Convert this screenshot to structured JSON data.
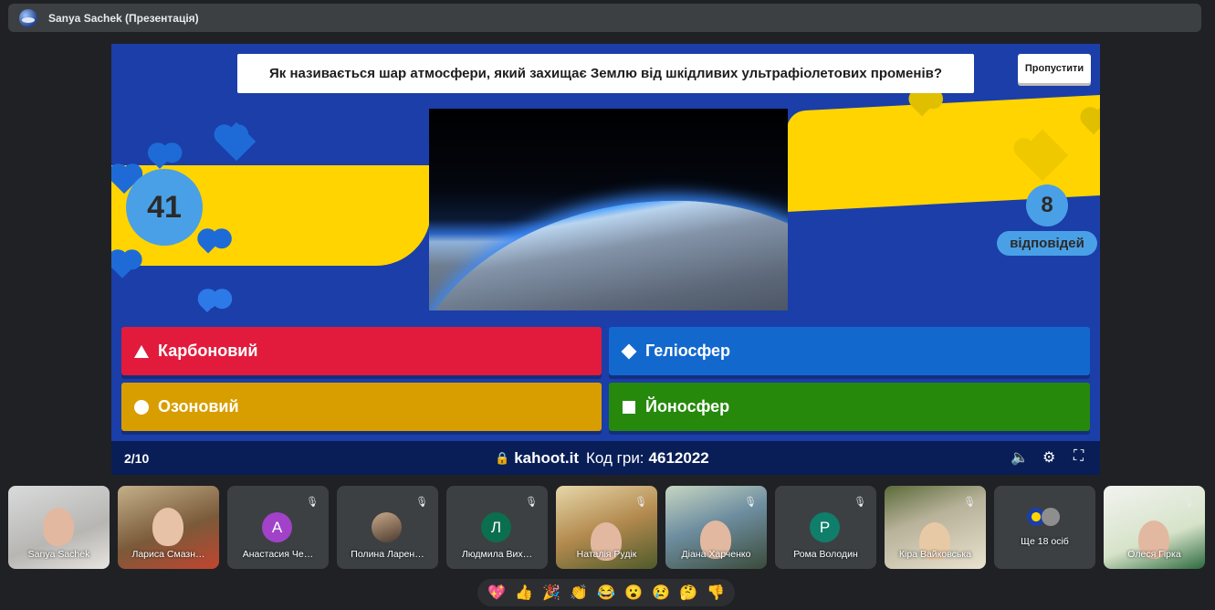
{
  "window": {
    "title": "Sanya Sachek (Презентація)"
  },
  "quiz": {
    "question": "Як називається шар атмосфери, який захищає Землю від шкідливих ультрафіолетових променів?",
    "skip_label": "Пропустити",
    "timer": "41",
    "answers_count": "8",
    "answers_label": "відповідей",
    "options": [
      {
        "shape": "triangle",
        "label": "Карбоновий",
        "color": "#e21b3c"
      },
      {
        "shape": "diamond",
        "label": "Геліосфер",
        "color": "#1368ce"
      },
      {
        "shape": "circle",
        "label": "Озоновий",
        "color": "#d89e00"
      },
      {
        "shape": "square",
        "label": "Йоносфер",
        "color": "#26890c"
      }
    ],
    "footer": {
      "progress": "2/10",
      "site": "kahoot.it",
      "pin_label": "Код гри:",
      "pin": "4612022"
    }
  },
  "participants": [
    {
      "name": "Sanya Sachek",
      "type": "camera"
    },
    {
      "name": "Лариса Смазн…",
      "type": "camera"
    },
    {
      "name": "Анастасия Че…",
      "type": "letter",
      "letter": "А",
      "color": "#a142c9",
      "muted": true
    },
    {
      "name": "Полина Ларен…",
      "type": "photo",
      "muted": true
    },
    {
      "name": "Людмила Вих…",
      "type": "letter",
      "letter": "Л",
      "color": "#0b6e4f",
      "muted": true
    },
    {
      "name": "Наталія Рудік",
      "type": "camera",
      "muted": true
    },
    {
      "name": "Діана Харченко",
      "type": "camera",
      "muted": true
    },
    {
      "name": "Рома Володин",
      "type": "letter",
      "letter": "Р",
      "color": "#0f7e6b",
      "muted": true
    },
    {
      "name": "Кіра Вайковська",
      "type": "camera",
      "muted": true
    },
    {
      "name": "Ще 18 осіб",
      "type": "more"
    },
    {
      "name": "Олеся Гірка",
      "type": "camera",
      "muted": true
    }
  ],
  "reactions": [
    "💖",
    "👍",
    "🎉",
    "👏",
    "😂",
    "😮",
    "😢",
    "🤔",
    "👎"
  ]
}
